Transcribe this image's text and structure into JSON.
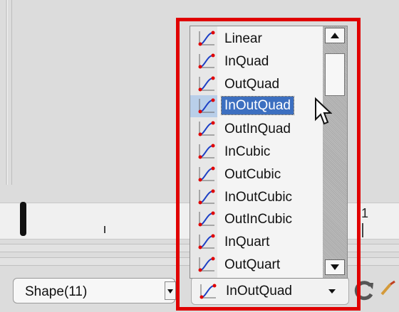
{
  "timeline": {
    "ruler_label": "1"
  },
  "shape_select": {
    "value": "Shape(11)"
  },
  "easing_combo": {
    "value": "InOutQuad"
  },
  "easing_list": {
    "selected": "InOutQuad",
    "items": [
      {
        "label": "Linear"
      },
      {
        "label": "InQuad"
      },
      {
        "label": "OutQuad"
      },
      {
        "label": "InOutQuad"
      },
      {
        "label": "OutInQuad"
      },
      {
        "label": "InCubic"
      },
      {
        "label": "OutCubic"
      },
      {
        "label": "InOutCubic"
      },
      {
        "label": "OutInCubic"
      },
      {
        "label": "InQuart"
      },
      {
        "label": "OutQuart"
      }
    ]
  },
  "colors": {
    "highlight": "#e00000",
    "selection": "#3c6fc0",
    "curve": "#1c3fc4",
    "curve_point": "#e00000"
  },
  "icons": {
    "curve": "easing-curve-icon",
    "refresh": "refresh-icon",
    "clip": "brush-icon"
  }
}
